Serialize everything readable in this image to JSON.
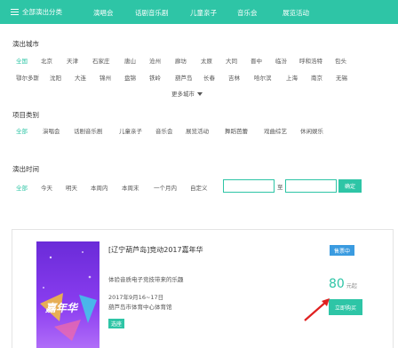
{
  "nav": {
    "all_label": "全部演出分类",
    "items": [
      "演唱会",
      "话剧音乐剧",
      "儿童亲子",
      "音乐会",
      "展览活动"
    ]
  },
  "city": {
    "title": "演出城市",
    "row1": [
      "全国",
      "北京",
      "天津",
      "石家庄",
      "唐山",
      "沧州",
      "廊坊",
      "太原",
      "大同",
      "晋中",
      "临汾",
      "呼和浩特",
      "包头"
    ],
    "row2": [
      "鄂尔多斯",
      "沈阳",
      "大连",
      "锦州",
      "盘锦",
      "铁岭",
      "葫芦岛",
      "长春",
      "吉林",
      "哈尔滨",
      "上海",
      "南京",
      "无锡"
    ],
    "more_label": "更多城市"
  },
  "category": {
    "title": "项目类别",
    "items": [
      "全部",
      "演唱会",
      "话剧音乐剧",
      "儿童亲子",
      "音乐会",
      "展览活动",
      "舞蹈芭蕾",
      "戏曲综艺",
      "休闲娱乐"
    ]
  },
  "time": {
    "title": "演出时间",
    "items": [
      "全部",
      "今天",
      "明天",
      "本周内",
      "本周末",
      "一个月内",
      "自定义"
    ],
    "separator": "至",
    "confirm_label": "确定"
  },
  "event": {
    "title": "[辽宁葫芦岛]竞动2017嘉年华",
    "description": "体验音质电子竞技带来的乐趣",
    "date": "2017年9月16~17日",
    "venue": "葫芦岛市体育中心体育馆",
    "badge_select": "选座",
    "badge_status": "售票中",
    "price": "80",
    "price_unit": "元起",
    "buy_label": "立即购买",
    "poster_text": "嘉年华"
  },
  "colors": {
    "accent": "#2ec5a6",
    "status": "#3a9be0",
    "arrow": "#e02020"
  }
}
